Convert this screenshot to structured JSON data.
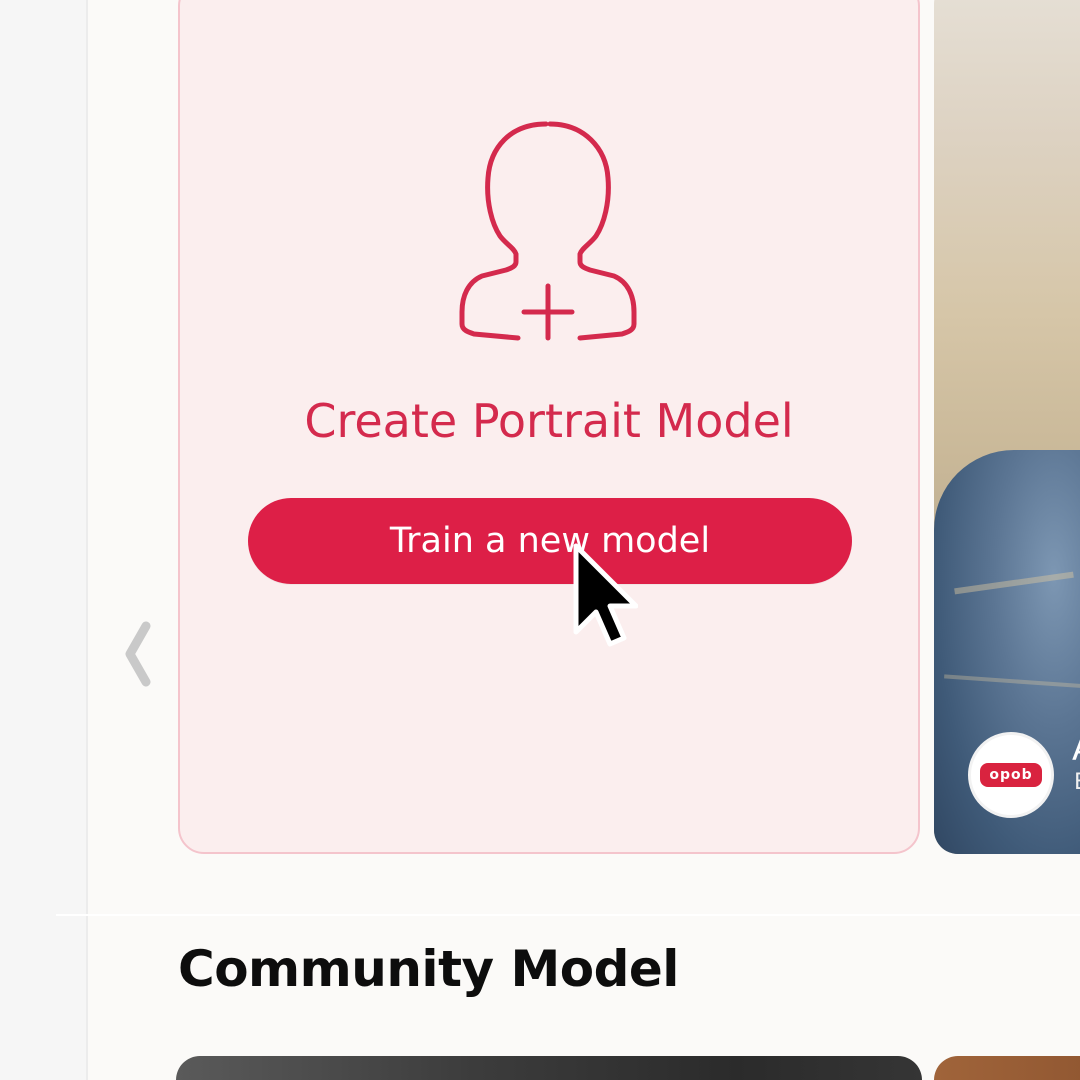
{
  "create_card": {
    "title": "Create Portrait Model",
    "button_label": "Train a new model",
    "icon": "portrait-add-icon",
    "accent_color": "#dd1f47"
  },
  "carousel": {
    "prev_icon": "chevron-left-icon"
  },
  "featured_card": {
    "badge_text": "opob",
    "title_fragment": "A",
    "subtitle_fragment": "E"
  },
  "community": {
    "section_title": "Community Model"
  }
}
